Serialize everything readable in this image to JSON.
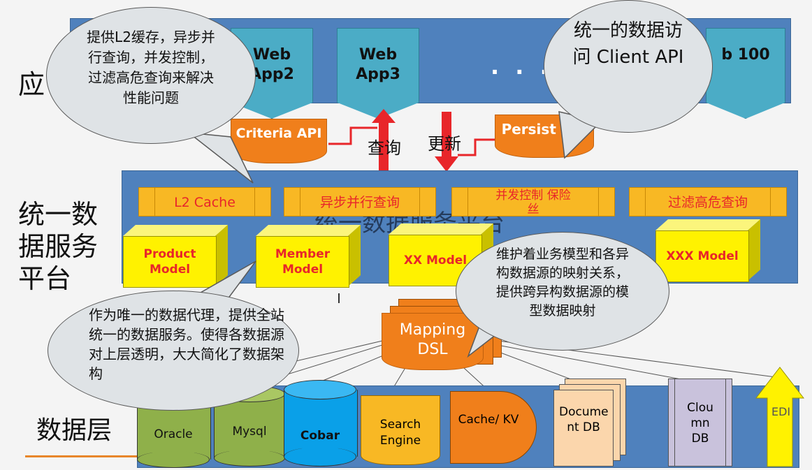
{
  "layers": {
    "app_label": "应",
    "platform_label": "统一数据服务平台",
    "platform_label_lines": [
      "统一数",
      "据服务",
      "平台"
    ],
    "data_label": "数据层"
  },
  "apps": [
    {
      "label": "Web App2"
    },
    {
      "label": "Web App3"
    },
    {
      "label": ". . ."
    },
    {
      "label": "b 100"
    }
  ],
  "apis": {
    "criteria": "Criteria API",
    "persist": "Persist API"
  },
  "arrows": {
    "query": "查询",
    "update": "更新"
  },
  "features": [
    "L2 Cache",
    "异步并行查询",
    "并发控制 保险丝",
    "过滤高危查询"
  ],
  "platform_title": "统一数据服务平台",
  "models": [
    "Product Model",
    "Member Model",
    "XX Model",
    "XXX Model"
  ],
  "mapping": "Mapping DSL",
  "datasources": {
    "oracle": "Oracle",
    "mysql": "Mysql",
    "cobar": "Cobar",
    "search": "Search Engine",
    "cache": "Cache/ KV",
    "document": "Docume nt DB",
    "column": "Clou mn DB",
    "edi": "EDI"
  },
  "bubbles": {
    "top_left": "提供L2缓存，异步并行查询，并发控制，过滤高危查询来解决性能问题",
    "top_right": "统一的数据访问 Client API",
    "middle_right": "维护着业务模型和各异构数据源的映射关系，提供跨异构数据源的模型数据映射",
    "bottom_left": "作为唯一的数据代理，提供全站统一的数据服务。使得各数据源对上层透明，大大简化了数据架构"
  },
  "colors": {
    "band_blue": "#4f81bd",
    "app_teal": "#4bacc6",
    "api_orange": "#f07f1b",
    "feature_gold": "#f8b824",
    "model_yellow": "#fff200",
    "red_text": "#e8262a"
  }
}
